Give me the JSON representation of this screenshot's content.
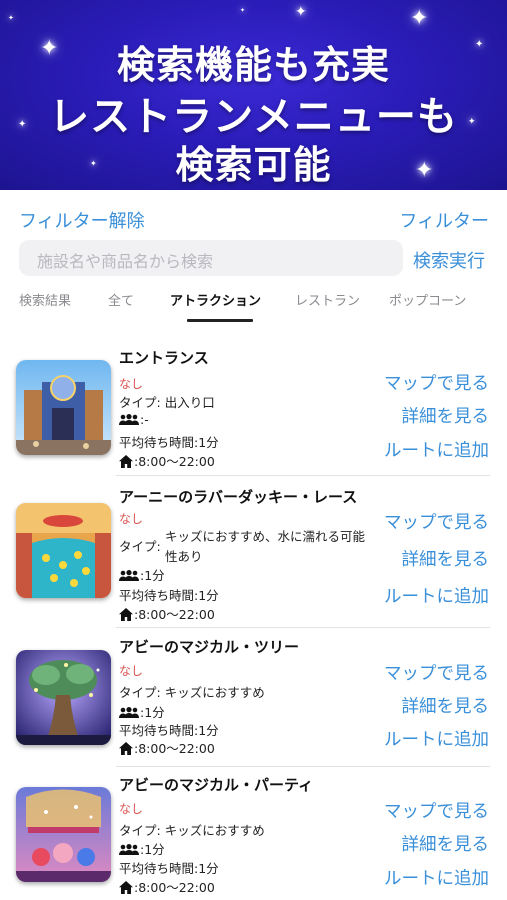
{
  "banner": {
    "line1": "検索機能も充実",
    "line2": "レストランメニューも",
    "line3": "検索可能"
  },
  "filter": {
    "clear_label": "フィルター解除",
    "filter_label": "フィルター"
  },
  "search": {
    "placeholder": "施設名や商品名から検索",
    "execute_label": "検索実行"
  },
  "tabs": [
    {
      "label": "検索結果",
      "active": false
    },
    {
      "label": "全て",
      "active": false
    },
    {
      "label": "アトラクション",
      "active": true
    },
    {
      "label": "レストラン",
      "active": false
    },
    {
      "label": "ポップコーン",
      "active": false
    }
  ],
  "icons": {
    "people": "people-icon",
    "home": "home-icon"
  },
  "colors": {
    "accent": "#3a8fd9",
    "warning": "#d9534f",
    "banner": "#2a1cb8"
  },
  "items": [
    {
      "title": "エントランス",
      "status": "なし",
      "type_label": "タイプ:",
      "type_value": "出入り口",
      "people": ":-",
      "wait": "平均待ち時間:1分",
      "hours": ":8:00～22:00",
      "map": "マップで見る",
      "detail": "詳細を見る",
      "route": "ルートに追加"
    },
    {
      "title": "アーニーのラバーダッキー・レース",
      "status": "なし",
      "type_label": "タイプ:",
      "type_value": "キッズにおすすめ、水に濡れる可能性あり",
      "people": ":1分",
      "wait": "平均待ち時間:1分",
      "hours": ":8:00～22:00",
      "map": "マップで見る",
      "detail": "詳細を見る",
      "route": "ルートに追加"
    },
    {
      "title": "アビーのマジカル・ツリー",
      "status": "なし",
      "type_label": "タイプ:",
      "type_value": "キッズにおすすめ",
      "people": ":1分",
      "wait": "平均待ち時間:1分",
      "hours": ":8:00～22:00",
      "map": "マップで見る",
      "detail": "詳細を見る",
      "route": "ルートに追加"
    },
    {
      "title": "アビーのマジカル・パーティ",
      "status": "なし",
      "type_label": "タイプ:",
      "type_value": "キッズにおすすめ",
      "people": ":1分",
      "wait": "平均待ち時間:1分",
      "hours": ":8:00～22:00",
      "map": "マップで見る",
      "detail": "詳細を見る",
      "route": "ルートに追加"
    }
  ]
}
